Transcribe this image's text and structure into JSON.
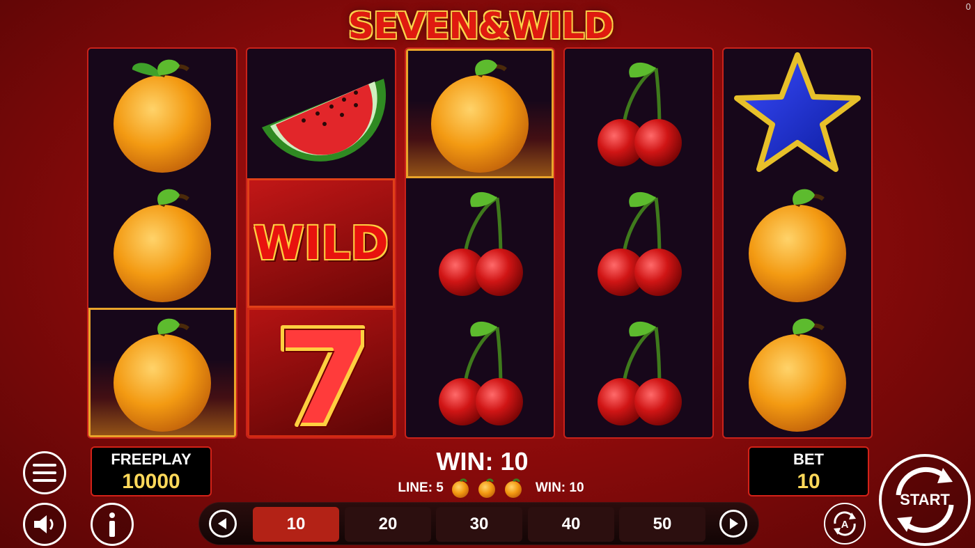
{
  "corner_counter": "0",
  "logo": {
    "text": "SEVEN&WILD"
  },
  "reels": [
    [
      "orange",
      "orange",
      "orange"
    ],
    [
      "watermelon",
      "wild",
      "seven"
    ],
    [
      "orange",
      "cherry",
      "cherry"
    ],
    [
      "cherry",
      "cherry",
      "cherry"
    ],
    [
      "star",
      "orange",
      "orange"
    ]
  ],
  "wild_label": "WILD",
  "seven_label": "7",
  "balance": {
    "label": "FREEPLAY",
    "value": "10000"
  },
  "bet": {
    "label": "BET",
    "value": "10"
  },
  "win": {
    "total": "WIN: 10",
    "line_label": "LINE: 5",
    "line_win": "WIN: 10",
    "line_symbols": [
      "orange",
      "orange",
      "orange"
    ]
  },
  "bet_options": [
    "10",
    "20",
    "30",
    "40",
    "50"
  ],
  "selected_bet_index": 0,
  "controls": {
    "menu_icon": "menu-icon",
    "sound_icon": "sound-icon",
    "info_icon": "info-icon",
    "autoplay_icon": "autoplay-icon",
    "start_label": "START"
  },
  "colors": {
    "accent_red": "#d32218",
    "value_yellow": "#ffd95a",
    "selected_bet": "#b32216"
  }
}
